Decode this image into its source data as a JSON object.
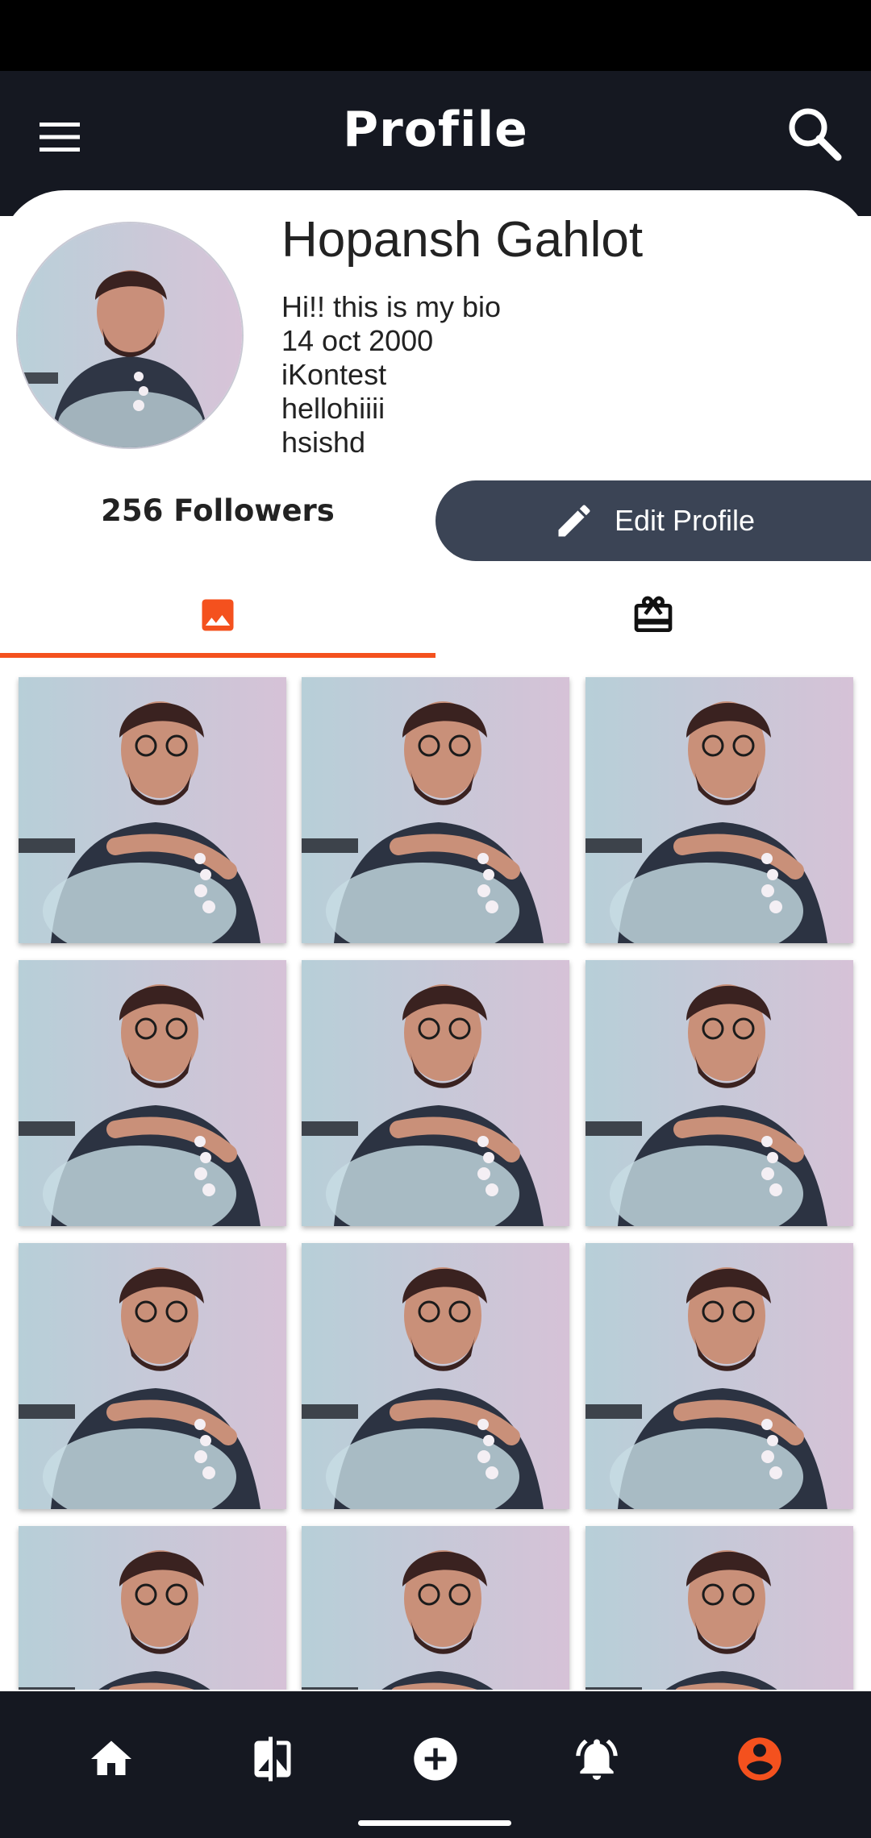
{
  "app_bar": {
    "title": "Profile"
  },
  "profile": {
    "name": "Hopansh Gahlot",
    "bio_lines": [
      "Hi!! this is my bio",
      "14 oct 2000",
      "iKontest",
      "hellohiiii",
      "hsishd"
    ],
    "followers": "256 Followers",
    "edit_label": "Edit Profile"
  },
  "tabs": [
    {
      "icon": "image-icon",
      "active": true
    },
    {
      "icon": "gift-card-icon",
      "active": false
    }
  ],
  "bottom_nav": [
    {
      "icon": "home-icon",
      "active": false
    },
    {
      "icon": "compare-icon",
      "active": false
    },
    {
      "icon": "add-circle-icon",
      "active": false
    },
    {
      "icon": "notifications-active-icon",
      "active": false
    },
    {
      "icon": "account-circle-icon",
      "active": true
    }
  ],
  "colors": {
    "app_bar_bg": "#151821",
    "accent": "#f4511e",
    "edit_button_bg": "#3b4455",
    "text": "#222222"
  }
}
